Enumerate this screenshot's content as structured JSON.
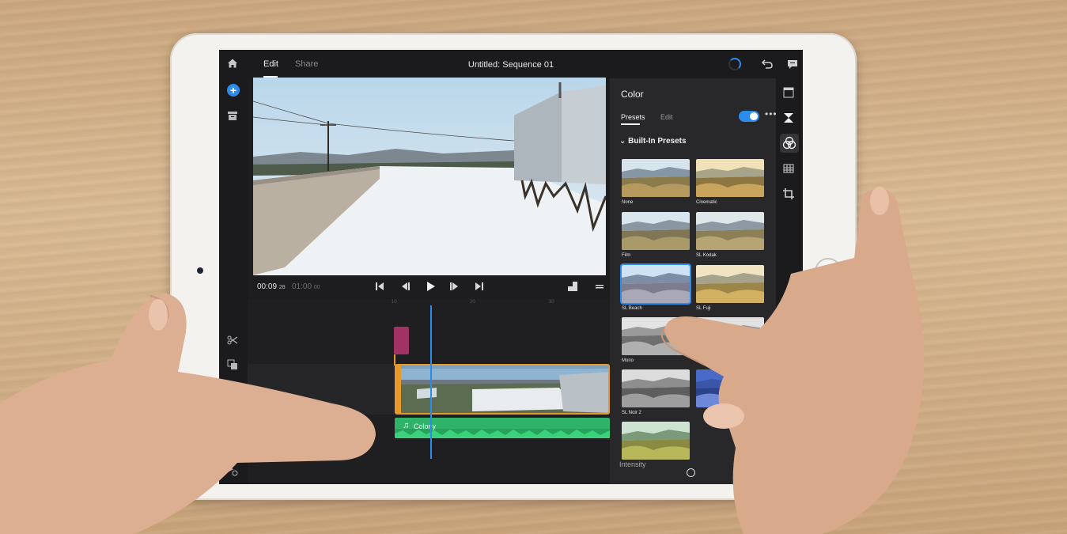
{
  "app": {
    "title": "Untitled: Sequence 01",
    "tabs": [
      {
        "label": "Edit",
        "active": true
      },
      {
        "label": "Share",
        "active": false
      }
    ],
    "accent_color": "#2d8ceb"
  },
  "transport": {
    "current_time": "00:09",
    "current_frames": "28",
    "duration": "01:00",
    "duration_frames": "00"
  },
  "timeline": {
    "ruler_marks": [
      "10",
      "20",
      "30"
    ],
    "audio_clip_label": "Colony",
    "clip_colors": {
      "title": "#a03264",
      "video_border": "#e79a2a",
      "audio": "#2fb36a"
    }
  },
  "color_panel": {
    "title": "Color",
    "subtabs": [
      {
        "label": "Presets",
        "active": true
      },
      {
        "label": "Edit",
        "active": false
      }
    ],
    "toggle_on": true,
    "section_title": "Built-In Presets",
    "presets": [
      {
        "label": "None",
        "selected": false
      },
      {
        "label": "Cinematic",
        "selected": false
      },
      {
        "label": "Film",
        "selected": false
      },
      {
        "label": "SL Kodak",
        "selected": false
      },
      {
        "label": "SL Beach",
        "selected": true
      },
      {
        "label": "SL Fuji",
        "selected": false
      },
      {
        "label": "Mono",
        "selected": false
      },
      {
        "label": "",
        "selected": false
      },
      {
        "label": "SL Noir 2",
        "selected": false
      },
      {
        "label": "",
        "selected": false
      },
      {
        "label": "",
        "selected": false
      }
    ],
    "intensity_label": "Intensity"
  }
}
